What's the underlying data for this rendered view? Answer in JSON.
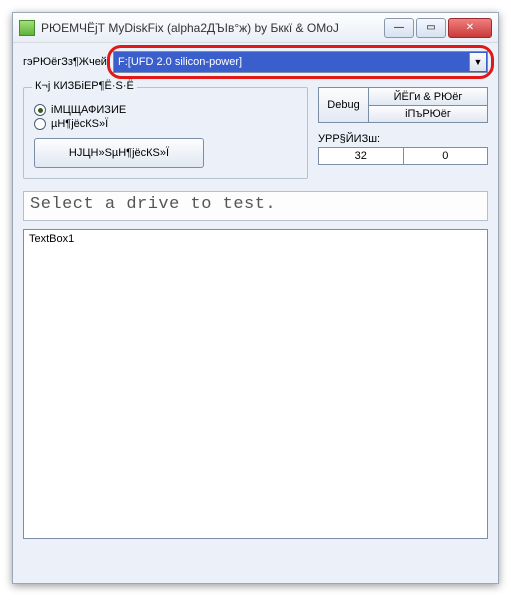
{
  "window": {
    "title": "РЮЕМЧЁјТ MyDiskFix (alpha2ДЪІв°ж) by Бккї & OMoJ"
  },
  "drive": {
    "label": "гэРЮёгЗз¶Жчей:",
    "selected": "F:[UFD 2.0 silicon-power]"
  },
  "scan_group": {
    "legend": "К¬ј КИЗБіЕР¶Ё·S·Ё",
    "radio1": "іМЦЩАФИЗИЕ",
    "radio2": "µН¶јёсКЅ»Ї",
    "button": "НЈЦН»ЅµН¶јёсКЅ»Ї"
  },
  "right": {
    "debug": "Debug",
    "btn1": "ЙЁГи & РЮёг",
    "btn2": "іПъРЮёг",
    "stats_label": "УРР§ЙИЗш:",
    "val1": "32",
    "val2": "0"
  },
  "status": "Select a drive to test.",
  "textbox": "TextBox1"
}
